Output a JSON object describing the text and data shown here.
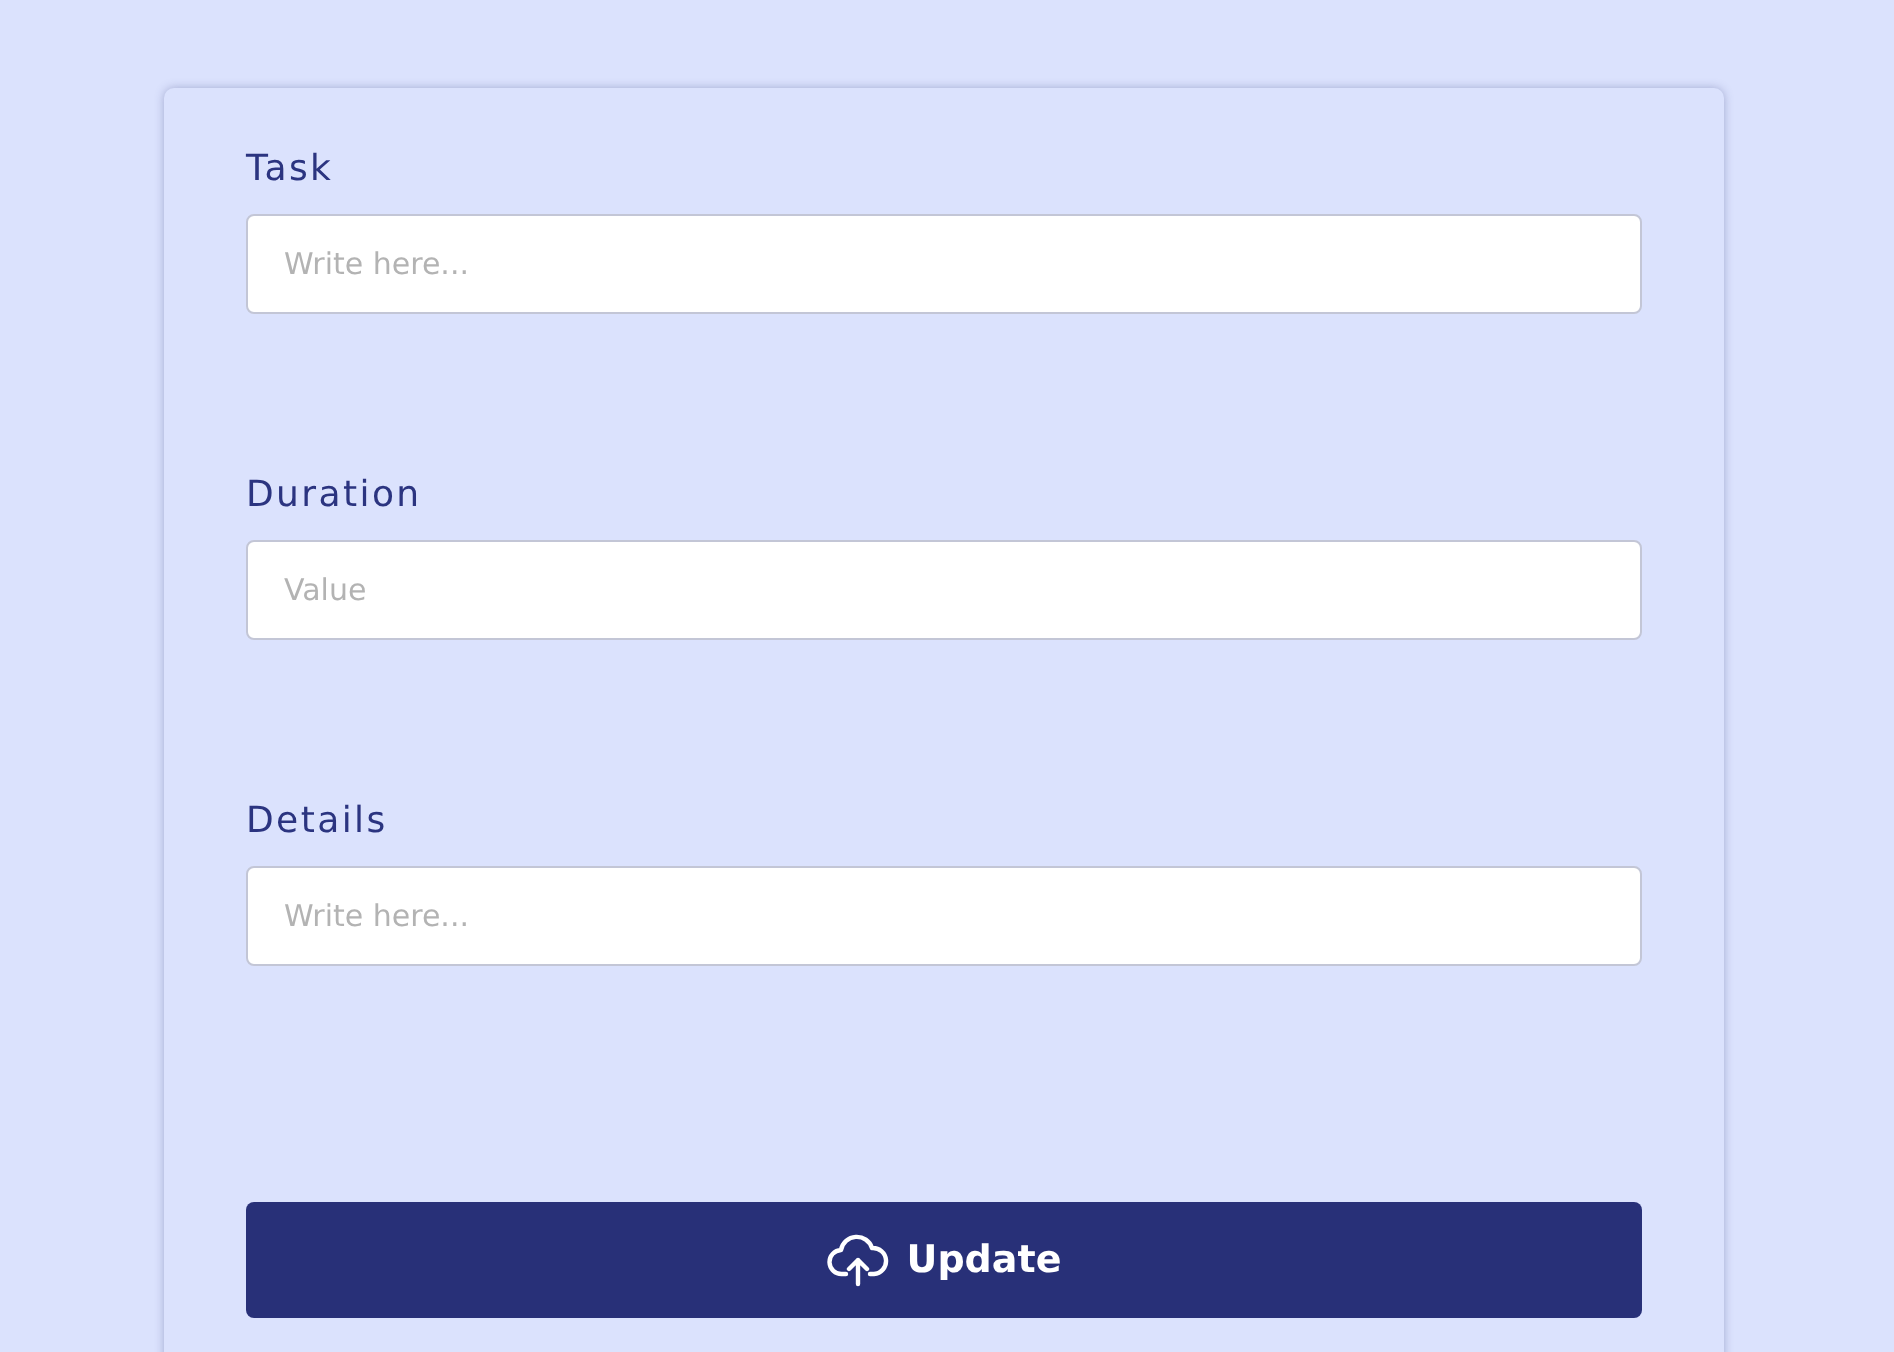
{
  "fields": [
    {
      "label": "Task",
      "placeholder": "Write here..."
    },
    {
      "label": "Duration",
      "placeholder": "Value"
    },
    {
      "label": "Details",
      "placeholder": "Write here..."
    }
  ],
  "button": {
    "label": "Update"
  }
}
